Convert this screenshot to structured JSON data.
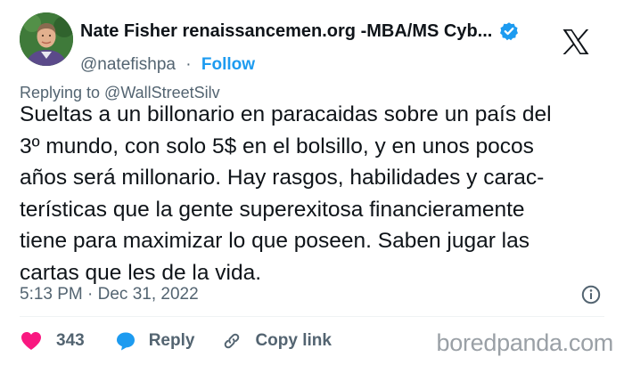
{
  "author": {
    "display_name": "Nate Fisher renaissancemen.org -MBA/MS Cyb...",
    "handle": "@natefishpa",
    "separator": "·",
    "follow_label": "Follow"
  },
  "reply_context": "Replying to @WallStreetSilv",
  "tweet": {
    "text": "Sueltas a un billonario en paracaidas sobre un país del\n3º mundo, con solo 5$ en el bolsillo, y en unos pocos\naños será millonario. Hay rasgos, habilidades y carac-\nterísticas que la gente superexitosa financieramente\ntiene para maximizar lo que poseen. Saben jugar las\ncartas que les de la vida.",
    "timestamp": "5:13 PM · Dec 31, 2022"
  },
  "actions": {
    "like_count": "343",
    "reply_label": "Reply",
    "copy_link_label": "Copy link"
  },
  "watermark": "boredpanda.com",
  "icons": {
    "verified": "verified-badge-icon",
    "platform": "x-logo-icon",
    "info": "info-icon",
    "like": "heart-icon",
    "reply": "speech-bubble-icon",
    "copy": "link-icon"
  },
  "colors": {
    "accent": "#1d9bf0",
    "like": "#f91880",
    "muted": "#536471",
    "text": "#0f1419",
    "watermark": "#9aa0a6"
  }
}
